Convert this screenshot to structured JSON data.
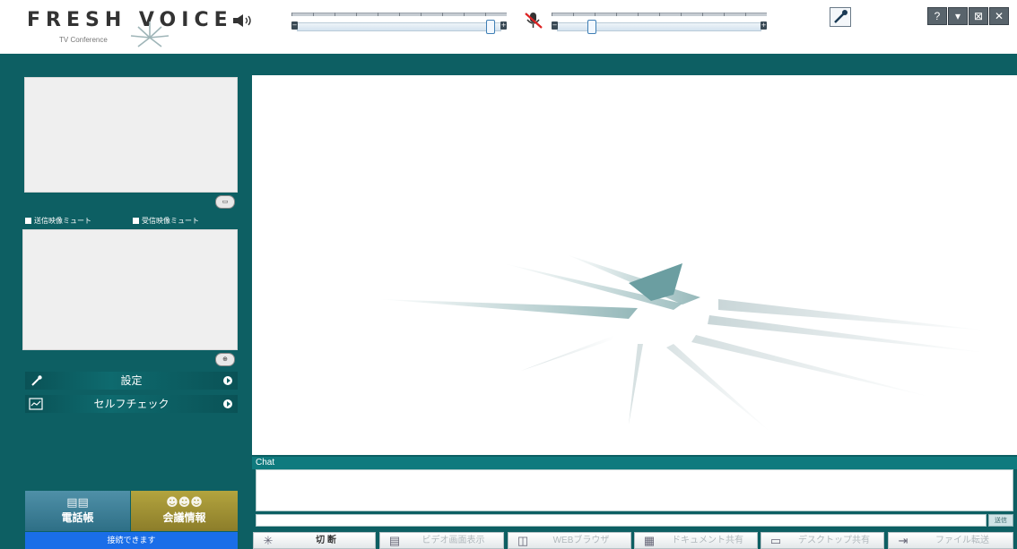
{
  "header": {
    "logo_text": "FRESH VOICE",
    "logo_subtitle": "TV Conference",
    "speaker_icon": "speaker-volume-icon",
    "mic_icon": "microphone-muted-icon",
    "speaker_volume": 0.96,
    "mic_volume": 0.14,
    "settings_icon": "wrench-icon",
    "help_label": "?",
    "menu_label": "▾",
    "minimize_label": "⊠",
    "close_label": "✕"
  },
  "left_panel": {
    "send_video_mute_label": "送信映像ミュート",
    "receive_video_mute_label": "受信映像ミュート",
    "menu": [
      {
        "label": "設定",
        "icon": "wrench-icon"
      },
      {
        "label": "セルフチェック",
        "icon": "self-check-icon"
      }
    ],
    "phonebook_label": "電話帳",
    "meeting_info_label": "会議情報",
    "status_text": "接続できます"
  },
  "chat": {
    "header_label": "Chat",
    "input_value": "",
    "send_label": "送信"
  },
  "toolbar": [
    {
      "label": "切 断",
      "icon": "disconnect-icon",
      "active": true
    },
    {
      "label": "ビデオ画面表示",
      "icon": "video-screen-icon",
      "active": false
    },
    {
      "label": "WEBブラウザ",
      "icon": "web-browser-icon",
      "active": false
    },
    {
      "label": "ドキュメント共有",
      "icon": "document-share-icon",
      "active": false
    },
    {
      "label": "デスクトップ共有",
      "icon": "desktop-share-icon",
      "active": false
    },
    {
      "label": "ファイル転送",
      "icon": "file-transfer-icon",
      "active": false
    }
  ],
  "colors": {
    "frame": "#0d5f63",
    "status_bar": "#1a6ee8",
    "phonebook": "#2e6f86",
    "meeting_info": "#8c7d2a"
  }
}
